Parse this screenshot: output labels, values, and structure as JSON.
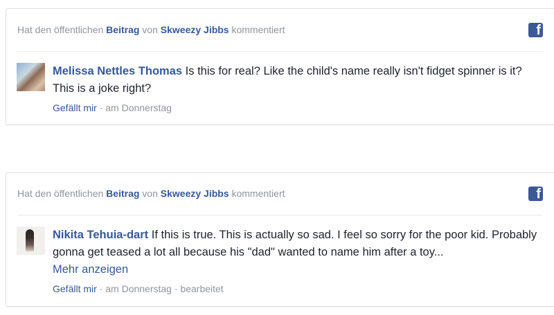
{
  "cards": [
    {
      "header": {
        "prefix": "Hat den öffentlichen",
        "post_link": "Beitrag",
        "middle": "von",
        "page_link": "Skweezy Jibbs",
        "suffix": "kommentiert"
      },
      "icon": "facebook-icon",
      "comment": {
        "author": "Melissa Nettles Thomas",
        "text": "Is this for real? Like the child's name really isn't fidget spinner is it? This is a joke right?"
      },
      "meta": {
        "like": "Gefällt mir",
        "sep": "·",
        "time": "am Donnerstag"
      }
    },
    {
      "header": {
        "prefix": "Hat den öffentlichen",
        "post_link": "Beitrag",
        "middle": "von",
        "page_link": "Skweezy Jibbs",
        "suffix": "kommentiert"
      },
      "icon": "facebook-icon",
      "comment": {
        "author": "Nikita Tehuia-dart",
        "text": "If this is true. This is actually so sad. I feel so sorry for the poor kid. Probably gonna get teased a lot all because his \"dad\" wanted to name him after a toy...",
        "more": "Mehr anzeigen"
      },
      "meta": {
        "like": "Gefällt mir",
        "sep": "·",
        "time": "am Donnerstag",
        "sep2": "·",
        "edited": "bearbeitet"
      }
    }
  ],
  "colors": {
    "link": "#365899",
    "muted": "#90949c",
    "text": "#1d2129",
    "facebook_blue": "#3b5998"
  }
}
